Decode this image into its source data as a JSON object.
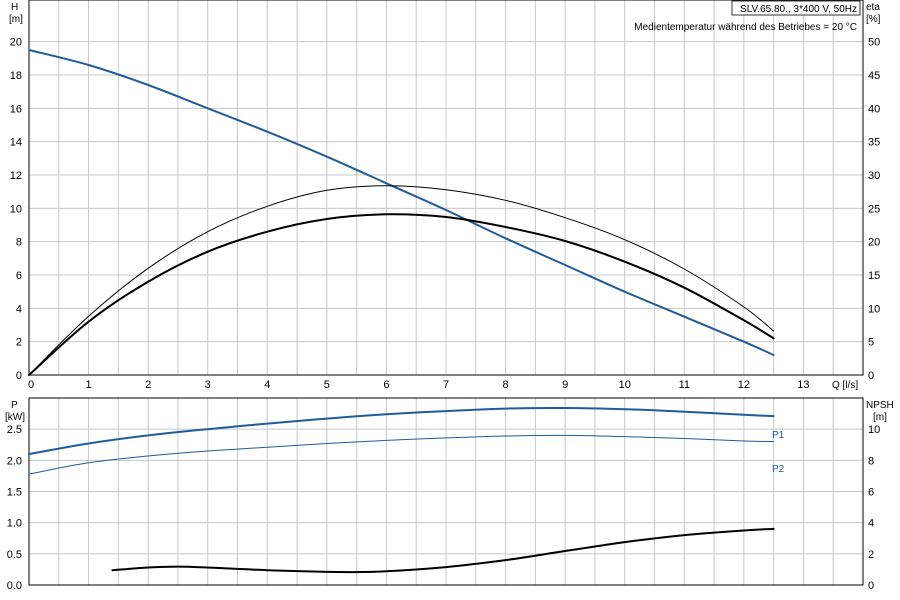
{
  "info": {
    "model": "SLV.65.80., 3*400 V, 50Hz",
    "note": "Medientemperatur während des Betriebes = 20 °C"
  },
  "colors": {
    "blue": "#1f5c99",
    "black": "#000000",
    "grid": "#c8c8c8"
  },
  "chart_data": [
    {
      "type": "line",
      "title": "",
      "xlabel": "Q [l/s]",
      "xlim": [
        0,
        14.0
      ],
      "xticks": [
        0,
        1,
        2,
        3,
        4,
        5,
        6,
        7,
        8,
        9,
        10,
        11,
        12,
        13
      ],
      "y_left": {
        "label_line1": "H",
        "label_line2": "[m]",
        "lim": [
          0,
          22.5
        ],
        "ticks": [
          0,
          2,
          4,
          6,
          8,
          10,
          12,
          14,
          16,
          18,
          20
        ]
      },
      "y_right": {
        "label_line1": "eta",
        "label_line2": "[%]",
        "lim": [
          0,
          56.25
        ],
        "ticks": [
          0,
          5,
          10,
          15,
          20,
          25,
          30,
          35,
          40,
          45,
          50
        ]
      },
      "grid": true,
      "series": [
        {
          "axis": "left",
          "color": "#1f5c99",
          "width": 2,
          "x": [
            0,
            1,
            2,
            3,
            4,
            5,
            6,
            7,
            8,
            9,
            10,
            11,
            12,
            12.5
          ],
          "y": [
            19.5,
            18.6,
            17.4,
            16.0,
            14.6,
            13.1,
            11.5,
            9.9,
            8.2,
            6.6,
            5.0,
            3.5,
            2.0,
            1.2
          ]
        },
        {
          "axis": "right",
          "color": "#000000",
          "width": 1,
          "x": [
            0,
            1,
            2,
            3,
            4,
            5,
            6,
            7,
            8,
            9,
            10,
            11,
            12,
            12.5
          ],
          "y": [
            0,
            8.8,
            16.0,
            21.5,
            25.3,
            27.7,
            28.4,
            27.8,
            26.2,
            23.6,
            20.3,
            15.9,
            10.2,
            6.6
          ]
        },
        {
          "axis": "right",
          "color": "#000000",
          "width": 2,
          "x": [
            0,
            1,
            2,
            3,
            4,
            5,
            6,
            7,
            8,
            9,
            10,
            11,
            12,
            12.5
          ],
          "y": [
            0,
            8.0,
            14.0,
            18.5,
            21.5,
            23.4,
            24.1,
            23.7,
            22.2,
            20.1,
            17.0,
            13.1,
            8.2,
            5.5
          ]
        }
      ]
    },
    {
      "type": "line",
      "title": "",
      "xlim": [
        0,
        14.0
      ],
      "y_left": {
        "label_line1": "P",
        "label_line2": "[kW]",
        "lim": [
          0,
          3.0
        ],
        "ticks": [
          0,
          0.5,
          1.0,
          1.5,
          2.0,
          2.5
        ],
        "tick_labels": [
          "0.0",
          "0.5",
          "1.0",
          "1.5",
          "2.0",
          "2.5"
        ]
      },
      "y_right": {
        "label_line1": "NPSH",
        "label_line2": "[m]",
        "lim": [
          0,
          12.0
        ],
        "ticks": [
          0,
          2,
          4,
          6,
          8,
          10
        ]
      },
      "grid": true,
      "series": [
        {
          "name": "P1",
          "axis": "left",
          "color": "#1f5c99",
          "width": 2,
          "x": [
            0,
            1,
            2,
            3,
            4,
            5,
            6,
            7,
            8,
            9,
            10,
            11,
            12,
            12.5
          ],
          "y": [
            2.1,
            2.27,
            2.4,
            2.5,
            2.59,
            2.67,
            2.74,
            2.79,
            2.83,
            2.84,
            2.82,
            2.78,
            2.73,
            2.71
          ]
        },
        {
          "name": "P2",
          "axis": "left",
          "color": "#1f5c99",
          "width": 1,
          "x": [
            0,
            1,
            2,
            3,
            4,
            5,
            6,
            7,
            8,
            9,
            10,
            11,
            12,
            12.5
          ],
          "y": [
            1.78,
            1.96,
            2.07,
            2.15,
            2.21,
            2.27,
            2.32,
            2.36,
            2.39,
            2.4,
            2.38,
            2.35,
            2.31,
            2.3
          ]
        },
        {
          "axis": "right",
          "color": "#000000",
          "width": 2,
          "x": [
            1.4,
            2,
            2.5,
            3,
            4,
            5,
            5.5,
            6,
            7,
            8,
            9,
            10,
            11,
            12,
            12.5
          ],
          "y": [
            0.95,
            1.12,
            1.18,
            1.12,
            0.95,
            0.84,
            0.83,
            0.88,
            1.15,
            1.6,
            2.18,
            2.75,
            3.2,
            3.5,
            3.6
          ]
        }
      ]
    }
  ]
}
